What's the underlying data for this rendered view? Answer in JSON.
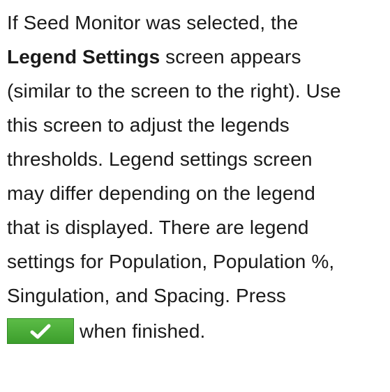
{
  "paragraph": {
    "line1": "If Seed Monitor was selected, the",
    "line2_bold": "Legend Settings",
    "line2_rest": " screen appears",
    "line3": "(similar to the screen to the right). Use",
    "line4": "this screen to adjust the legends",
    "line5": "thresholds. Legend settings screen",
    "line6": "may differ depending on the legend",
    "line7": "that is displayed. There are legend",
    "line8": "settings for Population, Population %,",
    "line9": "Singulation, and Spacing. Press",
    "line10_after_button": "when finished."
  },
  "accept_button": {
    "icon": "checkmark-icon",
    "color": "#4caf3a",
    "check_color": "#ffffff"
  }
}
